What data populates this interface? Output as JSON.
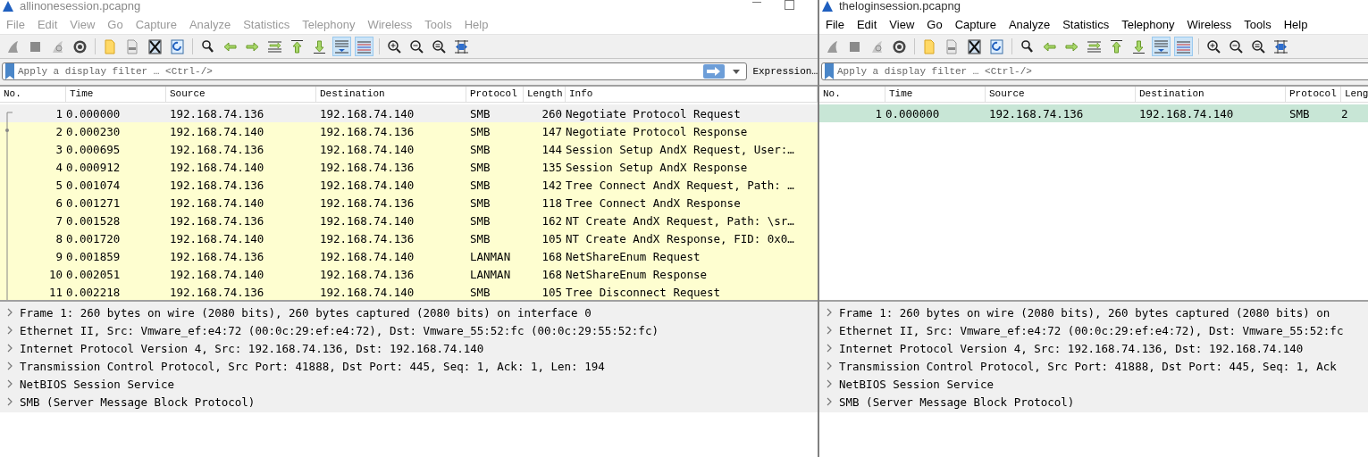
{
  "windows": [
    {
      "title": "allinonesession.pcapng",
      "active": false,
      "menu": [
        "File",
        "Edit",
        "View",
        "Go",
        "Capture",
        "Analyze",
        "Statistics",
        "Telephony",
        "Wireless",
        "Tools",
        "Help"
      ],
      "toolbar": [
        {
          "kind": "fin",
          "pressed": false
        },
        {
          "kind": "stop",
          "pressed": false
        },
        {
          "kind": "restart",
          "pressed": false
        },
        {
          "kind": "gear",
          "pressed": false
        },
        {
          "kind": "separator"
        },
        {
          "kind": "folder",
          "pressed": false
        },
        {
          "kind": "file",
          "pressed": false
        },
        {
          "kind": "close",
          "pressed": false
        },
        {
          "kind": "reload",
          "pressed": false
        },
        {
          "kind": "separator"
        },
        {
          "kind": "search",
          "pressed": false
        },
        {
          "kind": "back",
          "pressed": false
        },
        {
          "kind": "forward",
          "pressed": false
        },
        {
          "kind": "jump",
          "pressed": false
        },
        {
          "kind": "first",
          "pressed": false
        },
        {
          "kind": "last",
          "pressed": false
        },
        {
          "kind": "autoscroll",
          "pressed": true
        },
        {
          "kind": "colorize",
          "pressed": true
        },
        {
          "kind": "separator"
        },
        {
          "kind": "zoomin",
          "pressed": false
        },
        {
          "kind": "zoomout",
          "pressed": false
        },
        {
          "kind": "zoomreset",
          "pressed": false
        },
        {
          "kind": "columns",
          "pressed": false
        }
      ],
      "filter": {
        "placeholder": "Apply a display filter … <Ctrl-/>",
        "expression": "Expression…"
      },
      "columns": [
        "No.",
        "Time",
        "Source",
        "Destination",
        "Protocol",
        "Length",
        "Info"
      ],
      "rows": [
        {
          "cells": [
            "1",
            "0.000000",
            "192.168.74.136",
            "192.168.74.140",
            "SMB",
            "260",
            "Negotiate Protocol Request"
          ],
          "selected": true
        },
        {
          "cells": [
            "2",
            "0.000230",
            "192.168.74.140",
            "192.168.74.136",
            "SMB",
            "147",
            "Negotiate Protocol Response"
          ],
          "selected": false,
          "color": "#fefed0"
        },
        {
          "cells": [
            "3",
            "0.000695",
            "192.168.74.136",
            "192.168.74.140",
            "SMB",
            "144",
            "Session Setup AndX Request, User:…"
          ],
          "selected": false,
          "color": "#fefed0"
        },
        {
          "cells": [
            "4",
            "0.000912",
            "192.168.74.140",
            "192.168.74.136",
            "SMB",
            "135",
            "Session Setup AndX Response"
          ],
          "selected": false,
          "color": "#fefed0"
        },
        {
          "cells": [
            "5",
            "0.001074",
            "192.168.74.136",
            "192.168.74.140",
            "SMB",
            "142",
            "Tree Connect AndX Request, Path: …"
          ],
          "selected": false,
          "color": "#fefed0"
        },
        {
          "cells": [
            "6",
            "0.001271",
            "192.168.74.140",
            "192.168.74.136",
            "SMB",
            "118",
            "Tree Connect AndX Response"
          ],
          "selected": false,
          "color": "#fefed0"
        },
        {
          "cells": [
            "7",
            "0.001528",
            "192.168.74.136",
            "192.168.74.140",
            "SMB",
            "162",
            "NT Create AndX Request, Path: \\sr…"
          ],
          "selected": false,
          "color": "#fefed0"
        },
        {
          "cells": [
            "8",
            "0.001720",
            "192.168.74.140",
            "192.168.74.136",
            "SMB",
            "105",
            "NT Create AndX Response, FID: 0x0…"
          ],
          "selected": false,
          "color": "#fefed0"
        },
        {
          "cells": [
            "9",
            "0.001859",
            "192.168.74.136",
            "192.168.74.140",
            "LANMAN",
            "168",
            "NetShareEnum Request"
          ],
          "selected": false,
          "color": "#fefed0"
        },
        {
          "cells": [
            "10",
            "0.002051",
            "192.168.74.140",
            "192.168.74.136",
            "LANMAN",
            "168",
            "NetShareEnum Response"
          ],
          "selected": false,
          "color": "#fefed0"
        },
        {
          "cells": [
            "11",
            "0.002218",
            "192.168.74.136",
            "192.168.74.140",
            "SMB",
            "105",
            "Tree Disconnect Request"
          ],
          "selected": false,
          "color": "#fefed0"
        }
      ],
      "details": [
        {
          "text": "Frame 1: 260 bytes on wire (2080 bits), 260 bytes captured (2080 bits) on interface 0",
          "expanded": false
        },
        {
          "text": "Ethernet II, Src: Vmware_ef:e4:72 (00:0c:29:ef:e4:72), Dst: Vmware_55:52:fc (00:0c:29:55:52:fc)",
          "expanded": false
        },
        {
          "text": "Internet Protocol Version 4, Src: 192.168.74.136, Dst: 192.168.74.140",
          "expanded": false
        },
        {
          "text": "Transmission Control Protocol, Src Port: 41888, Dst Port: 445, Seq: 1, Ack: 1, Len: 194",
          "expanded": false
        },
        {
          "text": "NetBIOS Session Service",
          "expanded": false
        },
        {
          "text": "SMB (Server Message Block Protocol)",
          "expanded": false
        }
      ]
    },
    {
      "title": "theloginsession.pcapng",
      "active": true,
      "menu": [
        "File",
        "Edit",
        "View",
        "Go",
        "Capture",
        "Analyze",
        "Statistics",
        "Telephony",
        "Wireless",
        "Tools",
        "Help"
      ],
      "toolbar": [
        {
          "kind": "fin",
          "pressed": false
        },
        {
          "kind": "stop",
          "pressed": false
        },
        {
          "kind": "restart",
          "pressed": false
        },
        {
          "kind": "gear",
          "pressed": false
        },
        {
          "kind": "separator"
        },
        {
          "kind": "folder",
          "pressed": false
        },
        {
          "kind": "file",
          "pressed": false
        },
        {
          "kind": "close",
          "pressed": false
        },
        {
          "kind": "reload",
          "pressed": false
        },
        {
          "kind": "separator"
        },
        {
          "kind": "search",
          "pressed": false
        },
        {
          "kind": "back",
          "pressed": false
        },
        {
          "kind": "forward",
          "pressed": false
        },
        {
          "kind": "jump",
          "pressed": false
        },
        {
          "kind": "first",
          "pressed": false
        },
        {
          "kind": "last",
          "pressed": false
        },
        {
          "kind": "autoscroll",
          "pressed": true
        },
        {
          "kind": "colorize",
          "pressed": true
        },
        {
          "kind": "separator"
        },
        {
          "kind": "zoomin",
          "pressed": false
        },
        {
          "kind": "zoomout",
          "pressed": false
        },
        {
          "kind": "zoomreset",
          "pressed": false
        },
        {
          "kind": "columns",
          "pressed": false
        }
      ],
      "filter": {
        "placeholder": "Apply a display filter … <Ctrl-/>"
      },
      "columns": [
        "No.",
        "Time",
        "Source",
        "Destination",
        "Protocol",
        "Leng"
      ],
      "rows": [
        {
          "cells": [
            "1",
            "0.000000",
            "192.168.74.136",
            "192.168.74.140",
            "SMB",
            "2"
          ],
          "selected": false,
          "color": "#c8e6d6"
        }
      ],
      "details": [
        {
          "text": "Frame 1: 260 bytes on wire (2080 bits), 260 bytes captured (2080 bits) on",
          "expanded": false
        },
        {
          "text": "Ethernet II, Src: Vmware_ef:e4:72 (00:0c:29:ef:e4:72), Dst: Vmware_55:52:fc",
          "expanded": false
        },
        {
          "text": "Internet Protocol Version 4, Src: 192.168.74.136, Dst: 192.168.74.140",
          "expanded": false
        },
        {
          "text": "Transmission Control Protocol, Src Port: 41888, Dst Port: 445, Seq: 1, Ack",
          "expanded": false
        },
        {
          "text": "NetBIOS Session Service",
          "expanded": false
        },
        {
          "text": "SMB (Server Message Block Protocol)",
          "expanded": false
        }
      ]
    }
  ]
}
